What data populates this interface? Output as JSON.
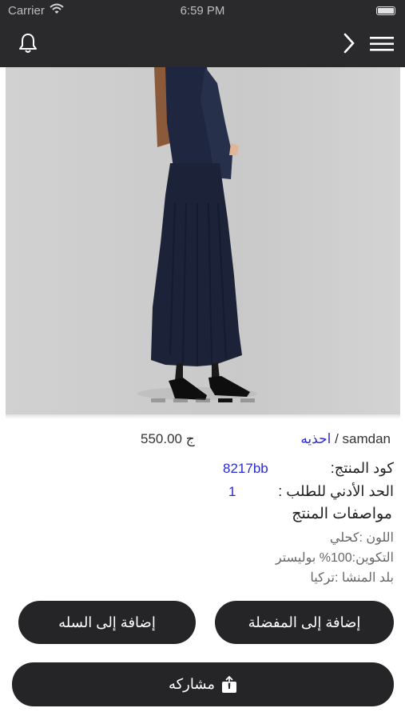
{
  "status_bar": {
    "carrier": "Carrier",
    "time": "6:59 PM"
  },
  "nav": {
    "left_icon": "bell-icon",
    "right_icons": [
      "chevron-right-icon",
      "hamburger-menu-icon"
    ]
  },
  "product": {
    "image_alt": "woman in navy long pleated dress",
    "carousel": {
      "count": 5,
      "active_index": 3
    },
    "price": "550.00 ج",
    "brand_prefix": "samdan /",
    "brand_link": "احذيه",
    "code_label": "كود المنتج:",
    "code_value": "8217bb",
    "min_order_label": "الحد الأدني للطلب :",
    "min_order_value": "1",
    "specs_title": "مواصفات المنتج",
    "specs": [
      "اللون :كحلي",
      "التكوين:100% بوليستر",
      "بلد المنشا :تركيا"
    ]
  },
  "actions": {
    "add_to_cart": "إضافة إلى السله",
    "add_to_favorites": "إضافة إلى المفضلة",
    "share": "مشاركه"
  },
  "colors": {
    "bar": "#2a2a2d",
    "button": "#252527",
    "link": "#2a2ad0"
  }
}
